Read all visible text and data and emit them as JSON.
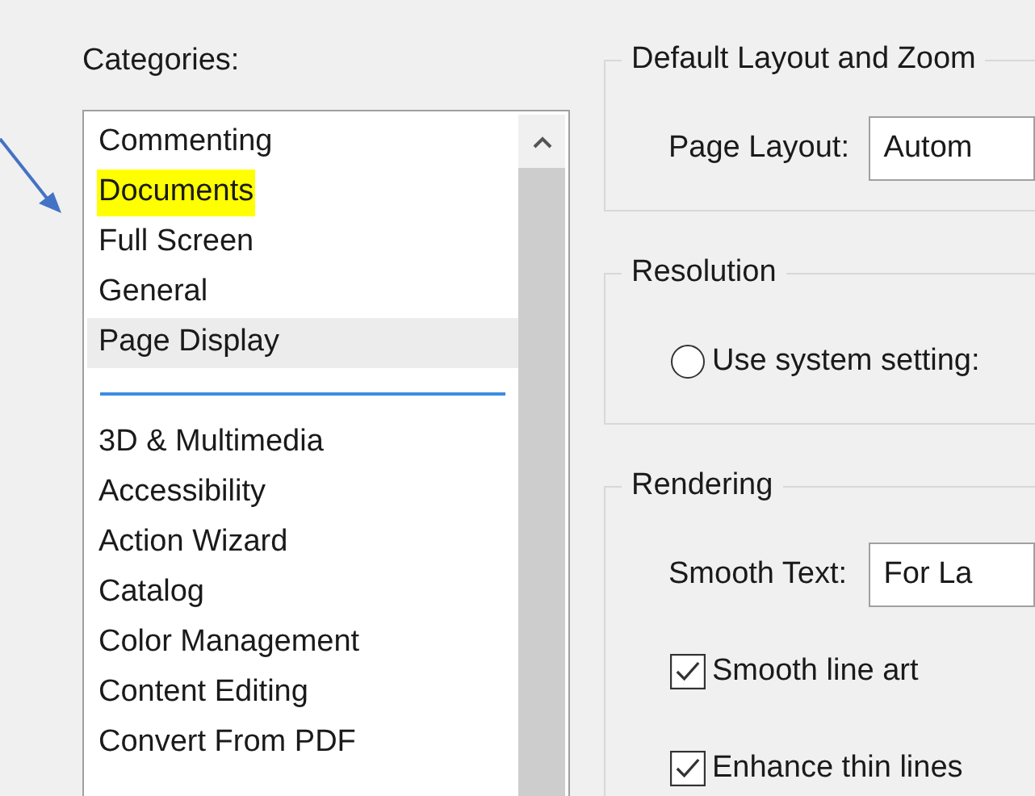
{
  "categories_label": "Categories:",
  "category_groups": [
    {
      "items": [
        {
          "label": "Commenting",
          "selected": false,
          "highlighted": false
        },
        {
          "label": "Documents",
          "selected": false,
          "highlighted": true
        },
        {
          "label": "Full Screen",
          "selected": false,
          "highlighted": false
        },
        {
          "label": "General",
          "selected": false,
          "highlighted": false
        },
        {
          "label": "Page Display",
          "selected": true,
          "highlighted": false
        }
      ]
    },
    {
      "items": [
        {
          "label": "3D & Multimedia",
          "selected": false,
          "highlighted": false
        },
        {
          "label": "Accessibility",
          "selected": false,
          "highlighted": false
        },
        {
          "label": "Action Wizard",
          "selected": false,
          "highlighted": false
        },
        {
          "label": "Catalog",
          "selected": false,
          "highlighted": false
        },
        {
          "label": "Color Management",
          "selected": false,
          "highlighted": false
        },
        {
          "label": "Content Editing",
          "selected": false,
          "highlighted": false
        },
        {
          "label": "Convert From PDF",
          "selected": false,
          "highlighted": false
        }
      ]
    }
  ],
  "groups": [
    {
      "title": "Default Layout and Zoom",
      "rows": [
        {
          "kind": "dropdown",
          "label": "Page Layout:",
          "value": "Autom"
        }
      ]
    },
    {
      "title": "Resolution",
      "rows": [
        {
          "kind": "radio",
          "label": "Use system setting:",
          "selected": false
        }
      ]
    },
    {
      "title": "Rendering",
      "rows": [
        {
          "kind": "dropdown",
          "label": "Smooth Text:",
          "value": "For La"
        },
        {
          "kind": "checkbox",
          "label": "Smooth line art",
          "checked": true
        },
        {
          "kind": "checkbox",
          "label": "Enhance thin lines",
          "checked": true
        }
      ]
    }
  ]
}
